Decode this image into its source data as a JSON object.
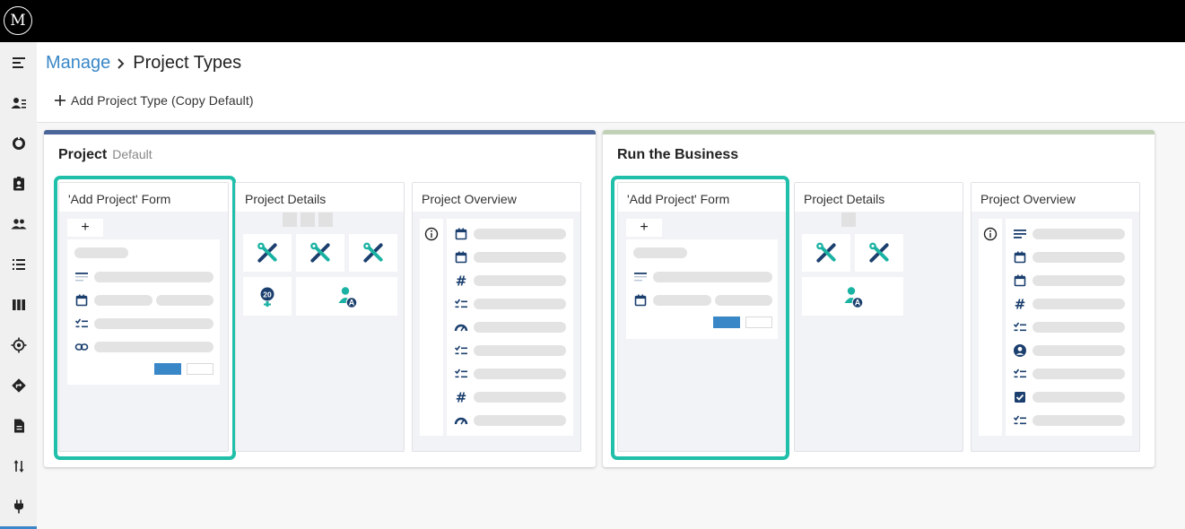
{
  "app": {
    "logo_text": "M"
  },
  "breadcrumb": {
    "parent": "Manage",
    "current": "Project Types"
  },
  "toolbar": {
    "add_label": "Add Project Type (Copy Default)"
  },
  "cards": [
    {
      "title": "Project",
      "subtitle": "Default",
      "accent": "#4a6597",
      "panels": {
        "form": "'Add Project' Form",
        "details": "Project Details",
        "overview": "Project Overview"
      }
    },
    {
      "title": "Run the Business",
      "subtitle": "",
      "accent": "#c0d1b6",
      "panels": {
        "form": "'Add Project' Form",
        "details": "Project Details",
        "overview": "Project Overview"
      }
    }
  ],
  "details_badge": "20",
  "assignee_badge": "A",
  "colors": {
    "accent_blue": "#3a87c7",
    "highlight": "#1fbfaa",
    "navy": "#1b3f6e",
    "teal": "#1ab2a2"
  }
}
